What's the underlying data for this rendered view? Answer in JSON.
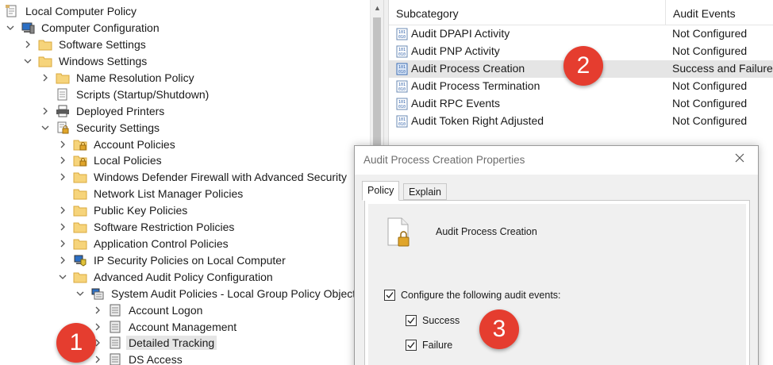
{
  "tree": {
    "root": "Local Computer Policy",
    "computer_configuration": "Computer Configuration",
    "software_settings": "Software Settings",
    "windows_settings": "Windows Settings",
    "name_resolution_policy": "Name Resolution Policy",
    "scripts": "Scripts (Startup/Shutdown)",
    "deployed_printers": "Deployed Printers",
    "security_settings": "Security Settings",
    "account_policies": "Account Policies",
    "local_policies": "Local Policies",
    "defender_firewall": "Windows Defender Firewall with Advanced Security",
    "network_list_manager": "Network List Manager Policies",
    "public_key_policies": "Public Key Policies",
    "software_restriction": "Software Restriction Policies",
    "application_control": "Application Control Policies",
    "ip_security": "IP Security Policies on Local Computer",
    "advanced_audit": "Advanced Audit Policy Configuration",
    "system_audit_policies": "System Audit Policies - Local Group Policy Object",
    "account_logon": "Account Logon",
    "account_management": "Account Management",
    "detailed_tracking": "Detailed Tracking",
    "ds_access": "DS Access"
  },
  "list": {
    "col_subcategory": "Subcategory",
    "col_audit_events": "Audit Events",
    "rows": [
      {
        "name": "Audit DPAPI Activity",
        "value": "Not Configured"
      },
      {
        "name": "Audit PNP Activity",
        "value": "Not Configured"
      },
      {
        "name": "Audit Process Creation",
        "value": "Success and Failure"
      },
      {
        "name": "Audit Process Termination",
        "value": "Not Configured"
      },
      {
        "name": "Audit RPC Events",
        "value": "Not Configured"
      },
      {
        "name": "Audit Token Right Adjusted",
        "value": "Not Configured"
      }
    ]
  },
  "dialog": {
    "title": "Audit Process Creation Properties",
    "tab_policy": "Policy",
    "tab_explain": "Explain",
    "policy_name": "Audit Process Creation",
    "configure_label": "Configure the following audit events:",
    "success_label": "Success",
    "failure_label": "Failure",
    "configure_checked": true,
    "success_checked": true,
    "failure_checked": true
  },
  "callouts": {
    "one": "1",
    "two": "2",
    "three": "3"
  },
  "colors": {
    "callout": "#e53d2f",
    "selection": "#e5e5e5"
  },
  "icons": [
    "policy-doc-icon",
    "computer-icon",
    "folder-icon",
    "scripts-icon",
    "printer-icon",
    "security-icon",
    "lock-folder-icon",
    "ipsec-icon",
    "audit-icon",
    "audit-item-icon",
    "close-icon",
    "chevron-right-icon",
    "chevron-down-icon"
  ]
}
